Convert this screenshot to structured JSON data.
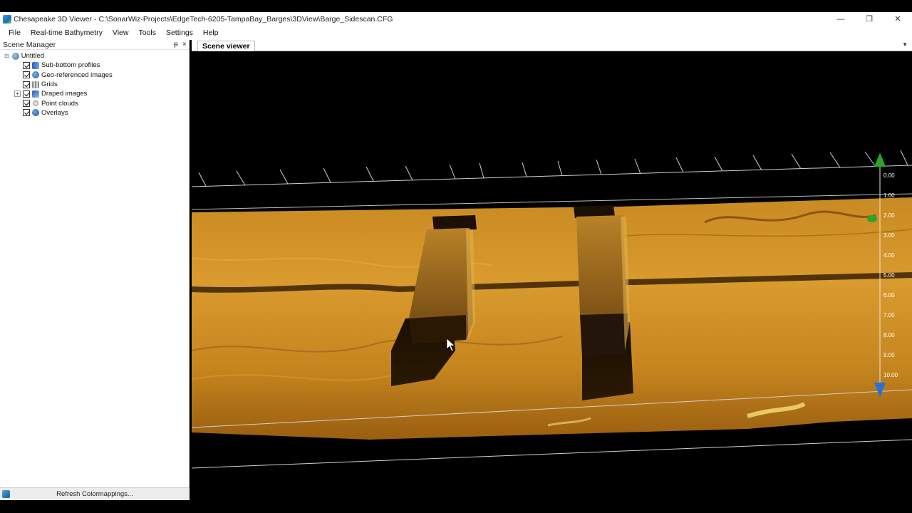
{
  "window": {
    "title": "Chesapeake 3D Viewer - C:\\SonarWiz-Projects\\EdgeTech-6205-TampaBay_Barges\\3DView\\Barge_Sidescan.CFG",
    "minimize": "—",
    "maximize": "❐",
    "close": "✕"
  },
  "menu": {
    "items": [
      "File",
      "Real-time Bathymetry",
      "View",
      "Tools",
      "Settings",
      "Help"
    ]
  },
  "scene_manager": {
    "title": "Scene Manager",
    "pin": "ᵽ",
    "close": "×",
    "root": "Untitled",
    "items": [
      {
        "label": "Sub-bottom profiles",
        "icon": "profile-icon",
        "checked": true
      },
      {
        "label": "Geo-referenced images",
        "icon": "globe-icon",
        "checked": true
      },
      {
        "label": "Grids",
        "icon": "grid-icon",
        "checked": true
      },
      {
        "label": "Draped images",
        "icon": "drape-icon",
        "checked": true,
        "expandable": true
      },
      {
        "label": "Point clouds",
        "icon": "point-cloud-icon",
        "checked": true
      },
      {
        "label": "Overlays",
        "icon": "overlay-icon",
        "checked": true
      }
    ],
    "footer_button": "Refresh Colormappings..."
  },
  "scene_viewer": {
    "tab_label": "Scene viewer",
    "dropdown": "▼",
    "depth_scale": [
      "0.00",
      "1.00",
      "2.00",
      "3.00",
      "4.00",
      "5.00",
      "6.00",
      "7.00",
      "8.00",
      "9.00",
      "10.00"
    ],
    "colors": {
      "seabed_light": "#d89a2a",
      "seabed_dark": "#7a4a08",
      "marker_green": "#2aa52a",
      "marker_blue": "#2b6fd6"
    }
  }
}
